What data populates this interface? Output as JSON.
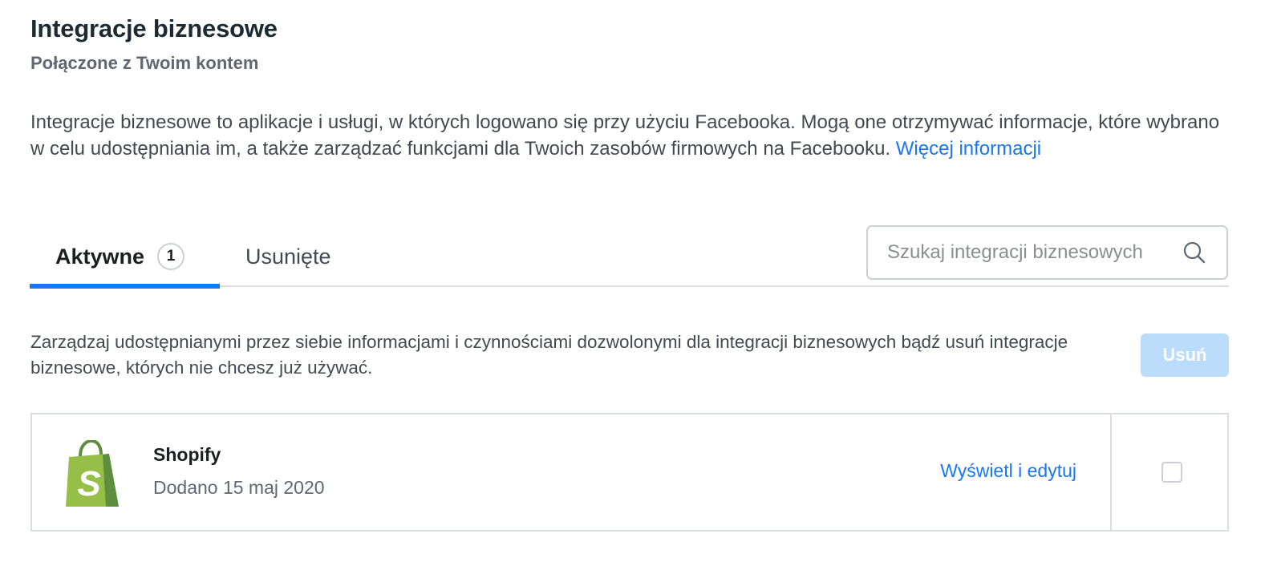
{
  "header": {
    "title": "Integracje biznesowe",
    "subtitle": "Połączone z Twoim kontem"
  },
  "intro": {
    "text": "Integracje biznesowe to aplikacje i usługi, w których logowano się przy użyciu Facebooka. Mogą one otrzymywać informacje, które wybrano w celu udostępniania im, a także zarządzać funkcjami dla Twoich zasobów firmowych na Facebooku. ",
    "link_label": "Więcej informacji"
  },
  "tabs": [
    {
      "label": "Aktywne",
      "count": "1",
      "active": true
    },
    {
      "label": "Usunięte",
      "active": false
    }
  ],
  "search": {
    "placeholder": "Szukaj integracji biznesowych",
    "value": "",
    "icon": "search-icon"
  },
  "manage": {
    "text": "Zarządzaj udostępnianymi przez siebie informacjami i czynnościami dozwolonymi dla integracji biznesowych bądź usuń integracje biznesowe, których nie chcesz już używać.",
    "remove_label": "Usuń"
  },
  "integrations": [
    {
      "name": "Shopify",
      "date": "Dodano 15 maj 2020",
      "action_label": "Wyświetl i edytuj",
      "icon": "shopify-logo-icon",
      "checked": false
    }
  ],
  "colors": {
    "accent": "#1877f2",
    "button_disabled": "#bcdcfc",
    "border": "#dadde1",
    "shopify_green": "#95bf47"
  }
}
